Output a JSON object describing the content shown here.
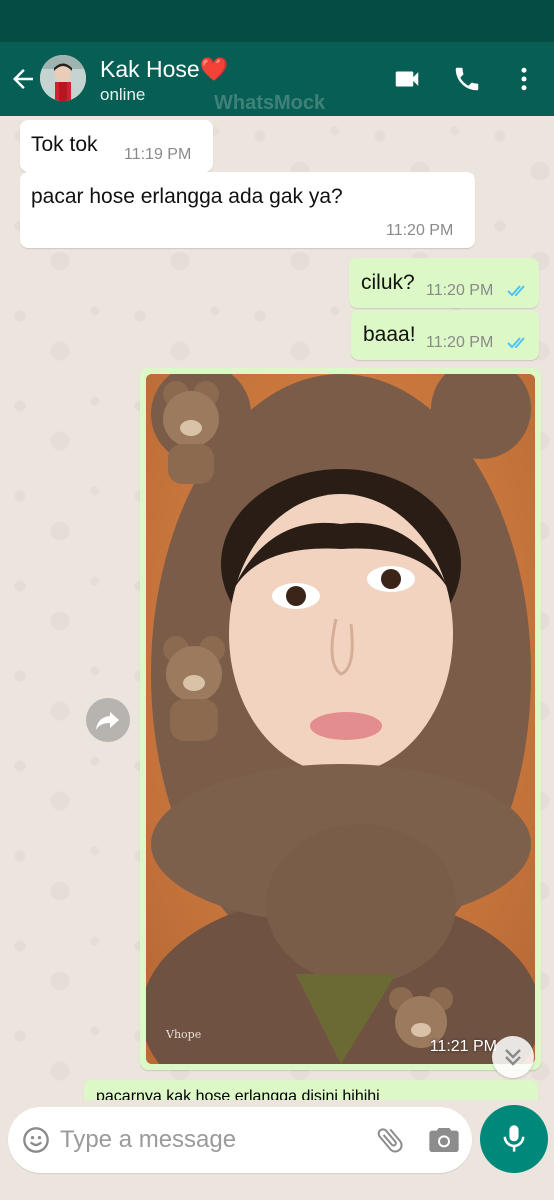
{
  "header": {
    "contact_name": "Kak Hose",
    "name_emoji": "❤️",
    "status": "online",
    "watermark": "WhatsMock",
    "icons": [
      "back-arrow-icon",
      "video-call-icon",
      "phone-call-icon",
      "more-vert-icon"
    ]
  },
  "messages": [
    {
      "direction": "incoming",
      "text": "Tok tok",
      "time": "11:19 PM"
    },
    {
      "direction": "incoming",
      "text": "pacar hose erlangga ada gak ya?",
      "time": "11:20 PM"
    },
    {
      "direction": "outgoing",
      "text": "ciluk?",
      "time": "11:20 PM",
      "status": "read"
    },
    {
      "direction": "outgoing",
      "text": "baaa!",
      "time": "11:20 PM",
      "status": "read"
    },
    {
      "direction": "outgoing",
      "type": "image",
      "time": "11:21 PM",
      "image_signature": "Vhope"
    },
    {
      "direction": "outgoing",
      "text": "pacarnya kak hose erlangga disini hihihi",
      "partial": true
    }
  ],
  "input": {
    "placeholder": "Type a message",
    "value": ""
  },
  "colors": {
    "header": "#075e54",
    "statusbar": "#054d44",
    "outgoing_bubble": "#dcf8c6",
    "incoming_bubble": "#ffffff",
    "chat_background": "#ece5dd",
    "read_ticks": "#4fc3f7",
    "fab": "#00897b"
  }
}
